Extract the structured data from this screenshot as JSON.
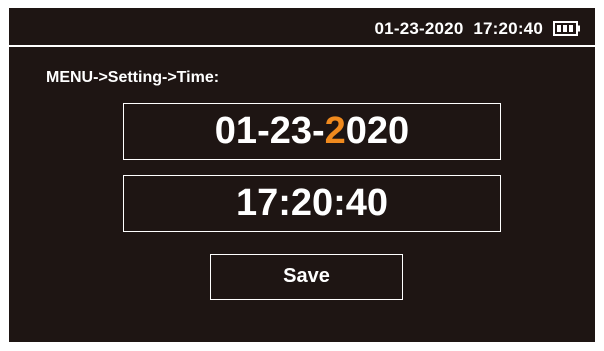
{
  "status_bar": {
    "datetime": "01-23-2020  17:20:40",
    "battery_icon": "battery-full-icon"
  },
  "breadcrumb": "MENU->Setting->Time:",
  "date_field": {
    "before_selected": "01-23-",
    "selected_digit": "2",
    "after_selected": "020"
  },
  "time_field": {
    "value": "17:20:40"
  },
  "save_button": {
    "label": "Save"
  },
  "colors": {
    "screen_background": "#1e1513",
    "text": "#ffffff",
    "selected_digit": "#f08a1e"
  }
}
